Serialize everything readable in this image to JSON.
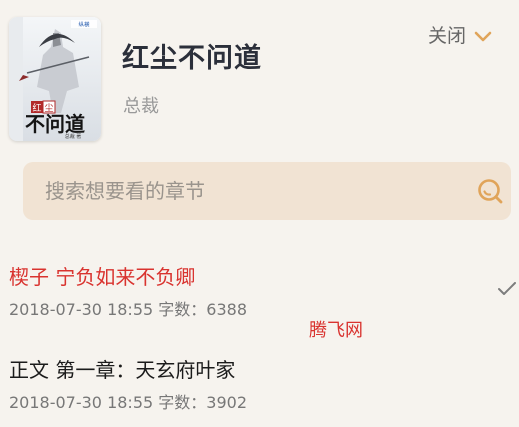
{
  "book": {
    "title": "红尘不问道",
    "author": "总裁",
    "cover_title": "红尘不问道",
    "cover_author": "总裁 著",
    "cover_publisher": "纵横"
  },
  "header": {
    "close_label": "关闭"
  },
  "search": {
    "placeholder": "搜索想要看的章节",
    "value": ""
  },
  "chapters": [
    {
      "title": "楔子 宁负如来不负卿",
      "date": "2018-07-30 18:55",
      "word_count_label": "字数：6388",
      "current": true
    },
    {
      "title": "正文 第一章：天玄府叶家",
      "date": "2018-07-30 18:55",
      "word_count_label": "字数：3902",
      "current": false
    }
  ],
  "watermark": "腾飞网",
  "colors": {
    "background": "#f6f3ee",
    "search_bg": "#f1e3d3",
    "accent_orange": "#e0a45a",
    "current_chapter": "#d9332f"
  },
  "icons": {
    "close": "chevron-down-icon",
    "search": "search-icon",
    "current": "checkmark-icon"
  }
}
